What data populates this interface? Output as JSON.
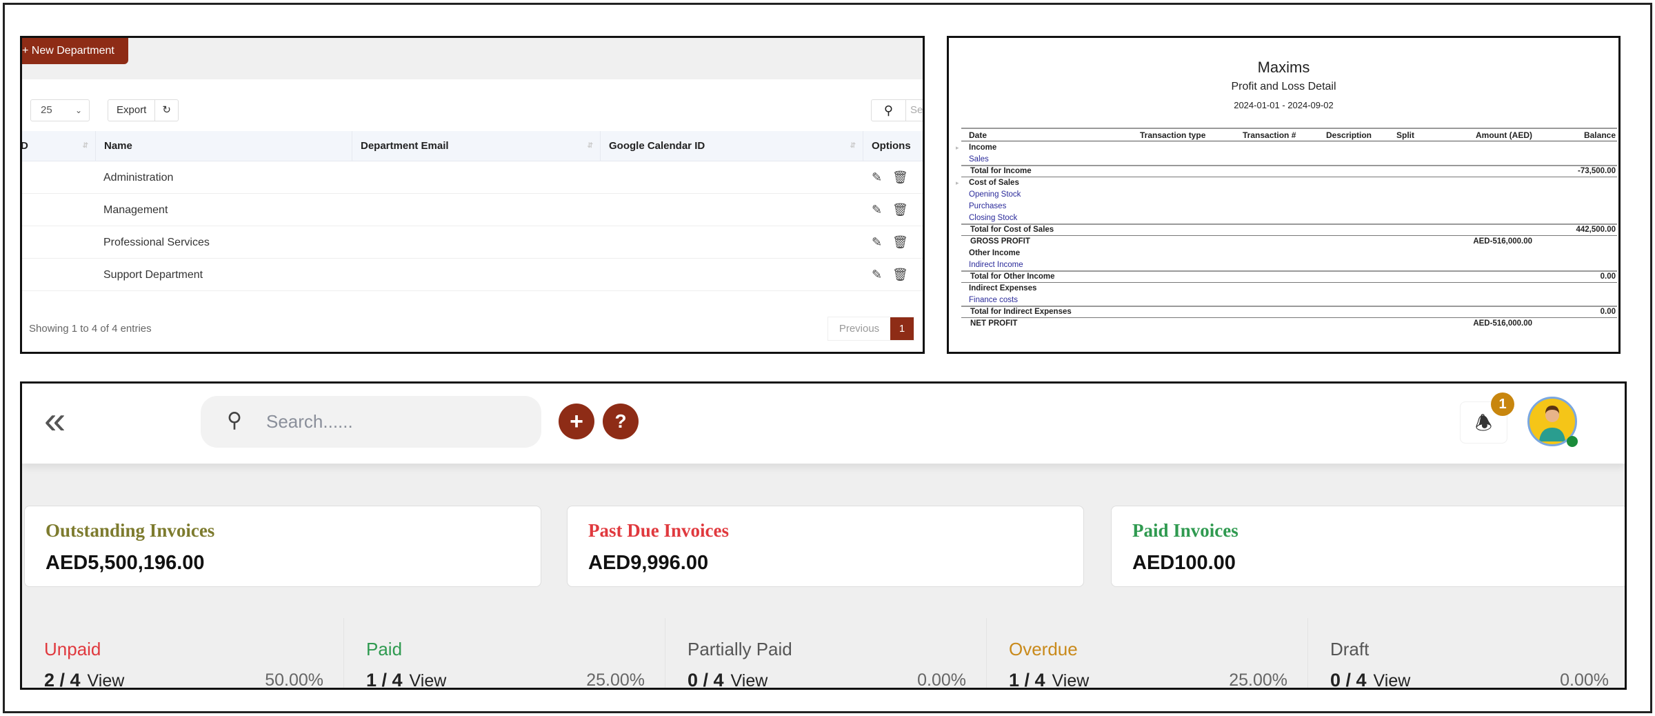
{
  "departments": {
    "new_button": "+ New Department",
    "page_size": "25",
    "export_label": "Export",
    "search_placeholder": "Se",
    "columns": [
      "D",
      "Name",
      "Department Email",
      "Google Calendar ID",
      "Options"
    ],
    "rows": [
      {
        "name": "Administration"
      },
      {
        "name": "Management"
      },
      {
        "name": "Professional Services"
      },
      {
        "name": "Support Department"
      }
    ],
    "footer": "Showing 1 to 4 of 4 entries",
    "prev_label": "Previous",
    "current_page": "1"
  },
  "report": {
    "company": "Maxims",
    "title": "Profit and Loss Detail",
    "period": "2024-01-01 - 2024-09-02",
    "columns": [
      "Date",
      "Transaction type",
      "Transaction #",
      "Description",
      "Split",
      "Amount (AED)",
      "Balance"
    ],
    "rows": [
      {
        "label": "Income",
        "style": "section",
        "amount": "",
        "balance": ""
      },
      {
        "label": "Sales",
        "style": "link",
        "amount": "",
        "balance": ""
      },
      {
        "label": "Total for Income",
        "style": "total",
        "amount": "",
        "balance": "-73,500.00"
      },
      {
        "label": "Cost of Sales",
        "style": "section",
        "amount": "",
        "balance": ""
      },
      {
        "label": "Opening Stock",
        "style": "link",
        "amount": "",
        "balance": ""
      },
      {
        "label": "Purchases",
        "style": "link",
        "amount": "",
        "balance": ""
      },
      {
        "label": "Closing Stock",
        "style": "link",
        "amount": "",
        "balance": ""
      },
      {
        "label": "Total for Cost of Sales",
        "style": "total",
        "amount": "",
        "balance": "442,500.00"
      },
      {
        "label": "GROSS PROFIT",
        "style": "total-line",
        "amount": "AED-516,000.00",
        "balance": ""
      },
      {
        "label": "Other Income",
        "style": "section-plain",
        "amount": "",
        "balance": ""
      },
      {
        "label": "Indirect Income",
        "style": "link",
        "amount": "",
        "balance": ""
      },
      {
        "label": "Total for Other Income",
        "style": "total",
        "amount": "",
        "balance": "0.00"
      },
      {
        "label": "Indirect Expenses",
        "style": "section-plain",
        "amount": "",
        "balance": ""
      },
      {
        "label": "Finance costs",
        "style": "link",
        "amount": "",
        "balance": ""
      },
      {
        "label": "Total for Indirect Expenses",
        "style": "total",
        "amount": "",
        "balance": "0.00"
      },
      {
        "label": "NET PROFIT",
        "style": "total-line",
        "amount": "AED-516,000.00",
        "balance": ""
      }
    ]
  },
  "dashboard": {
    "search_placeholder": "Search......",
    "notification_count": "1",
    "brand_color": "#8e2c16",
    "cards": [
      {
        "title": "Outstanding Invoices",
        "value": "AED5,500,196.00",
        "color": "#7d7b2e"
      },
      {
        "title": "Past Due Invoices",
        "value": "AED9,996.00",
        "color": "#e0393e"
      },
      {
        "title": "Paid Invoices",
        "value": "AED100.00",
        "color": "#2f9a50"
      }
    ],
    "stats": [
      {
        "label": "Unpaid",
        "count": "2 / 4",
        "view": "View",
        "percent": "50.00%",
        "color": "#e0393e"
      },
      {
        "label": "Paid",
        "count": "1 / 4",
        "view": "View",
        "percent": "25.00%",
        "color": "#2f9a50"
      },
      {
        "label": "Partially Paid",
        "count": "0 / 4",
        "view": "View",
        "percent": "0.00%",
        "color": "#555555"
      },
      {
        "label": "Overdue",
        "count": "1 / 4",
        "view": "View",
        "percent": "25.00%",
        "color": "#c98a1b"
      },
      {
        "label": "Draft",
        "count": "0 / 4",
        "view": "View",
        "percent": "0.00%",
        "color": "#555555"
      }
    ]
  }
}
